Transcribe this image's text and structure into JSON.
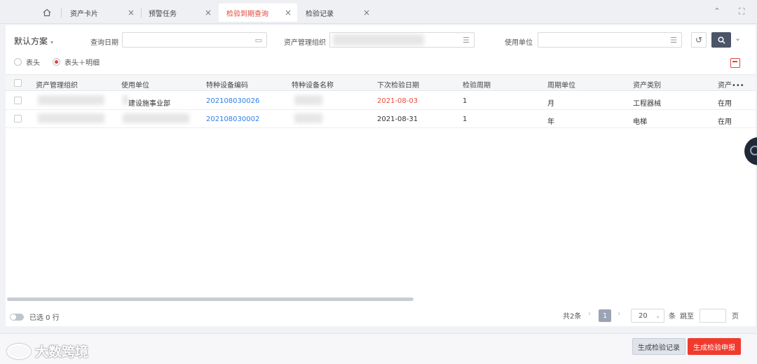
{
  "tabs": [
    {
      "label": "资产卡片",
      "closable": true,
      "active": false
    },
    {
      "label": "预警任务",
      "closable": true,
      "active": false
    },
    {
      "label": "检验到期查询",
      "closable": true,
      "active": true
    },
    {
      "label": "检验记录",
      "closable": true,
      "active": false
    }
  ],
  "icons": {
    "home": "home-icon",
    "close": "×",
    "collapse": "chevron-up-double-icon",
    "fullscreen": "fullscreen-icon"
  },
  "filters": {
    "scheme_label": "默认方案",
    "query_date_label": "查询日期",
    "asset_org_label": "资产管理组织",
    "use_unit_label": "使用单位"
  },
  "view_options": [
    {
      "label": "表头",
      "selected": false
    },
    {
      "label": "表头＋明细",
      "selected": true
    }
  ],
  "table": {
    "columns": [
      "资产管理组织",
      "使用单位",
      "特种设备编码",
      "特种设备名称",
      "下次检验日期",
      "检验周期",
      "周期单位",
      "资产类别",
      "资产•••"
    ],
    "rows": [
      {
        "org": "",
        "unit": "建设施事业部",
        "code": "202108030026",
        "name": "",
        "next_date": "2021-08-03",
        "next_date_overdue": true,
        "period": "1",
        "period_unit": "月",
        "category": "工程器械",
        "status": "在用"
      },
      {
        "org": "",
        "unit": "",
        "code": "202108030002",
        "name": "",
        "next_date": "2021-08-31",
        "next_date_overdue": false,
        "period": "1",
        "period_unit": "年",
        "category": "电梯",
        "status": "在用"
      }
    ]
  },
  "footer": {
    "selected_text": "已选 0 行",
    "total_text": "共2条",
    "current_page": "1",
    "page_size": "20",
    "page_size_unit": "条",
    "jump_label": "跳至",
    "page_label": "页"
  },
  "actions": {
    "generate_record": "生成检验记录",
    "generate_apply": "生成检验申报"
  },
  "watermark": "大数跨境",
  "colors": {
    "accent": "#e0463a",
    "link": "#2f7ee8",
    "search_button": "#4a5568",
    "apply_button": "#f03a2e"
  }
}
